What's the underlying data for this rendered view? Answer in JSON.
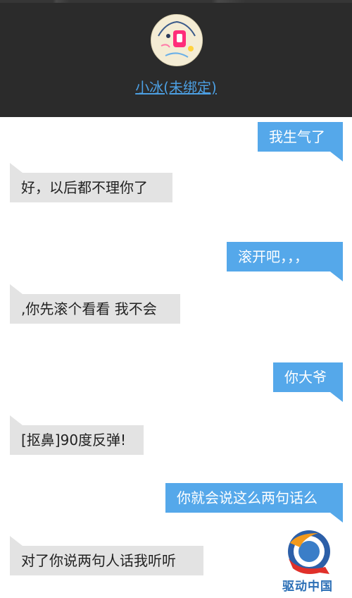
{
  "header": {
    "contact_name": "小冰(未绑定)"
  },
  "messages": [
    {
      "from": "me",
      "text": "我生气了"
    },
    {
      "from": "bot",
      "text": "好，以后都不理你了"
    },
    {
      "from": "me",
      "text": "滚开吧，，，"
    },
    {
      "from": "bot",
      "text": ",你先滚个看看 我不会"
    },
    {
      "from": "me",
      "text": "你大爷"
    },
    {
      "from": "bot",
      "text": "[抠鼻]90度反弹!"
    },
    {
      "from": "me",
      "text": "你就会说这么两句话么"
    },
    {
      "from": "bot",
      "text": "对了你说两句人话我听听"
    }
  ],
  "watermark": {
    "text": "驱动中国"
  },
  "colors": {
    "header_bg": "#2b2b2b",
    "sent_bubble": "#55a8ea",
    "received_bubble": "#e3e3e3",
    "link": "#4c9fe2"
  }
}
